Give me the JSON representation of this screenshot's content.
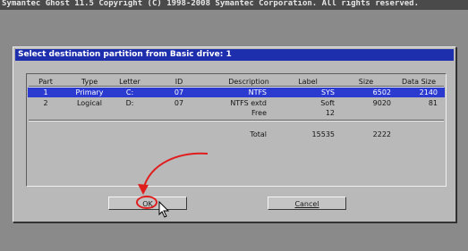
{
  "top_bar": {
    "text": "Symantec Ghost 11.5   Copyright (C) 1998-2008 Symantec Corporation. All rights reserved."
  },
  "dialog": {
    "title": "Select destination partition from Basic drive: 1",
    "columns": [
      "Part",
      "Type",
      "Letter",
      "ID",
      "Description",
      "Label",
      "Size",
      "Data Size"
    ],
    "rows": [
      {
        "part": "1",
        "type": "Primary",
        "letter": "C:",
        "id": "07",
        "description": "NTFS",
        "label": "SYS",
        "size": "6502",
        "data_size": "2140",
        "selected": true
      },
      {
        "part": "2",
        "type": "Logical",
        "letter": "D:",
        "id": "07",
        "description": "NTFS extd",
        "label": "Soft",
        "size": "9020",
        "data_size": "81",
        "selected": false
      },
      {
        "part": "",
        "type": "",
        "letter": "",
        "id": "",
        "description": "Free",
        "label": "12",
        "size": "",
        "data_size": "",
        "selected": false
      }
    ],
    "total": {
      "label": "Total",
      "value1": "15535",
      "value2": "2222"
    },
    "buttons": {
      "ok_label": "OK",
      "cancel_label": "Cancel"
    }
  },
  "colors": {
    "selection": "#2b3bd0",
    "titlebar": "#1e2fae",
    "annotation": "#e01d1d"
  }
}
